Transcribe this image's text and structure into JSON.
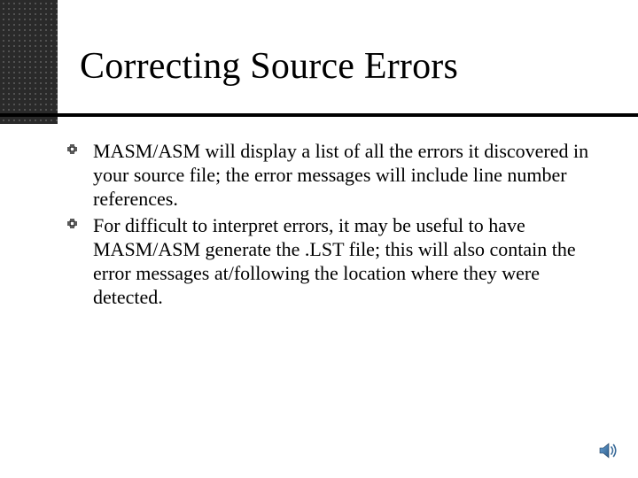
{
  "title": "Correcting Source Errors",
  "bullets": [
    "MASM/ASM will display a list of all the errors it discovered in your source file; the error messages will include line number references.",
    "For difficult to interpret errors, it may be useful to have MASM/ASM generate the .LST file; this will also contain the error messages at/following the location where they were detected."
  ]
}
